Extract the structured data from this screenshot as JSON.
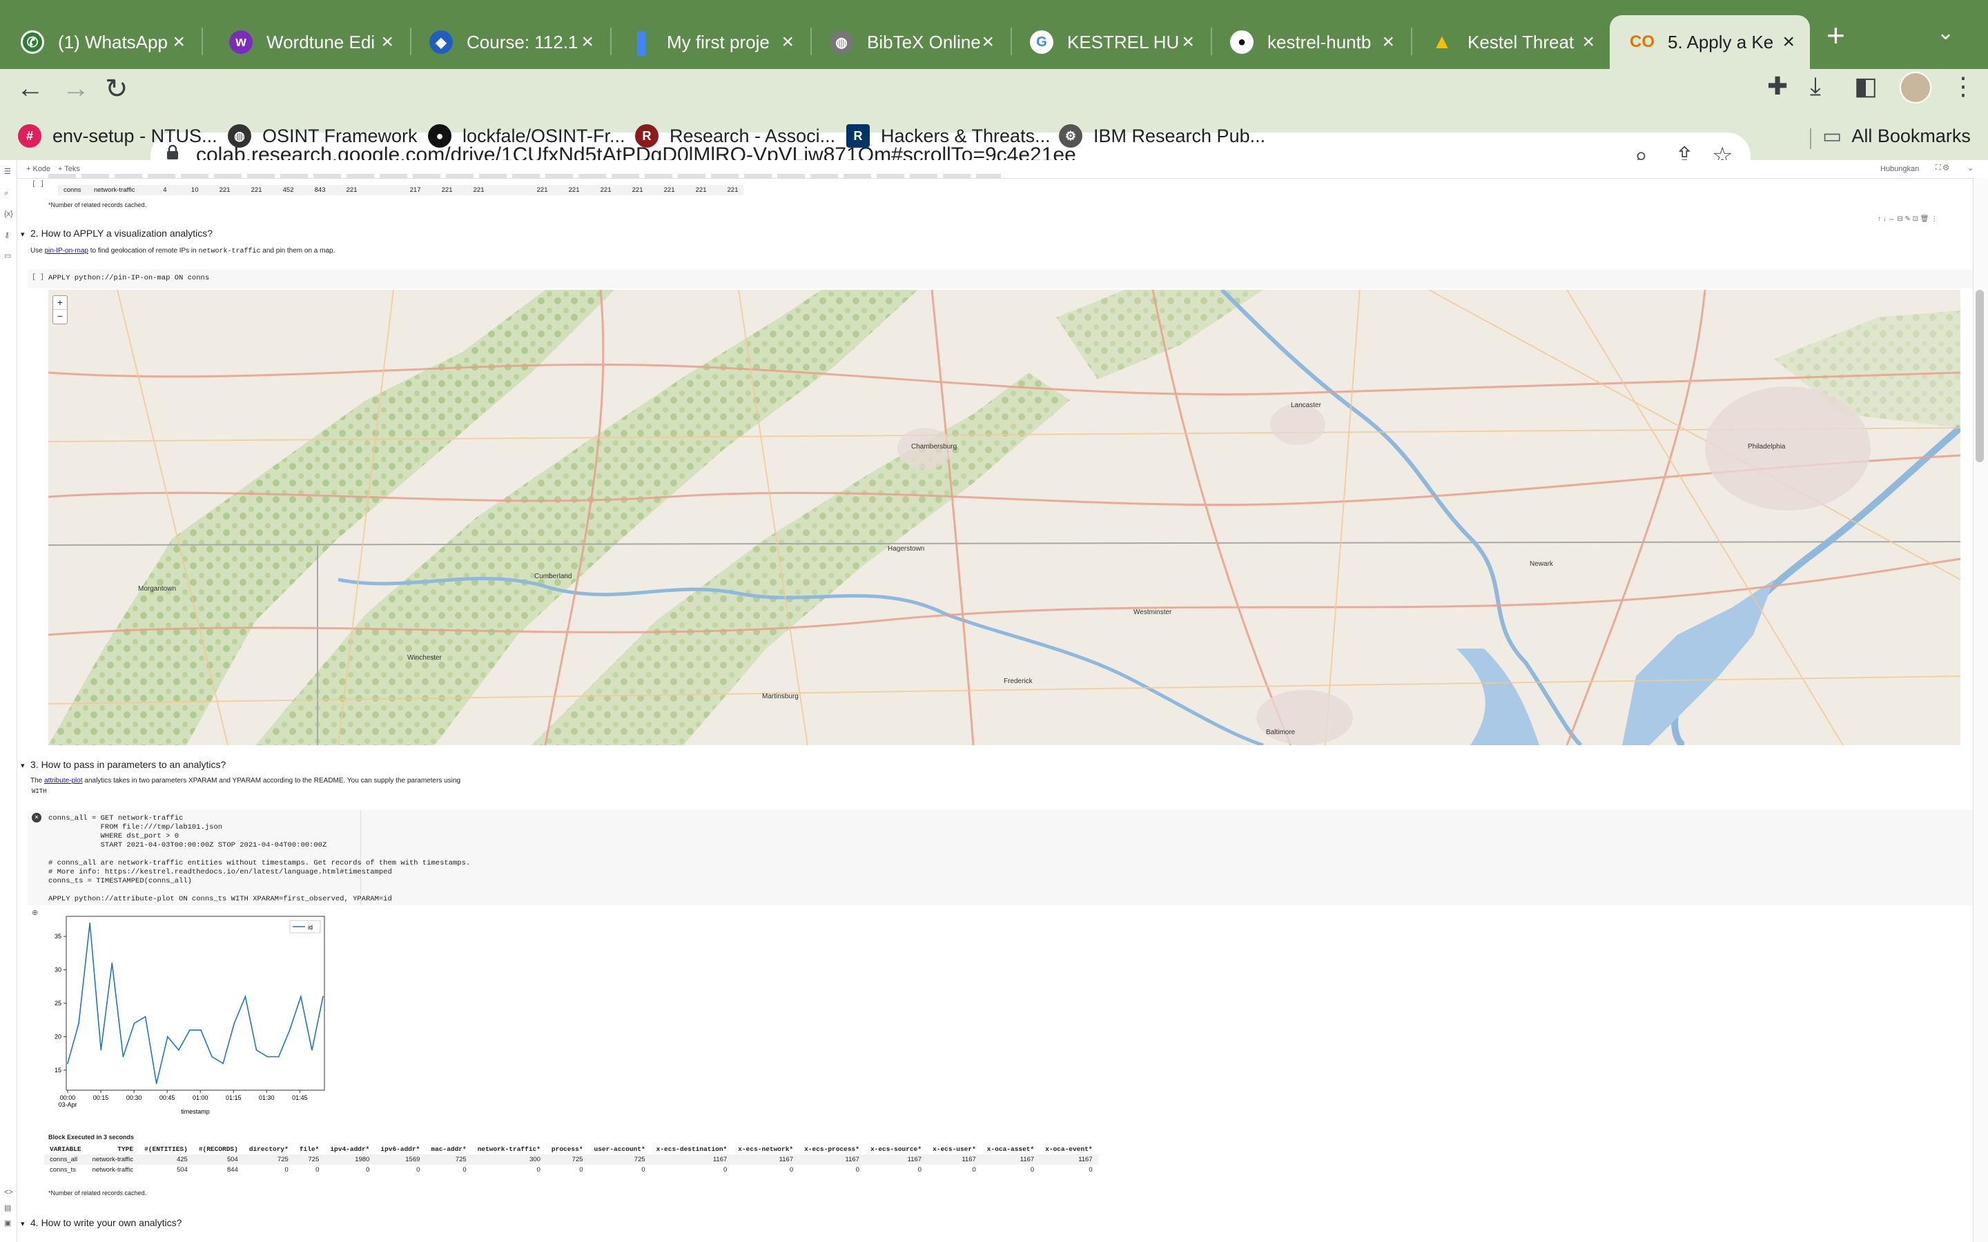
{
  "browser": {
    "tabs": [
      {
        "label": "(1) WhatsApp",
        "icon": "whatsapp-icon",
        "color": "#25d366"
      },
      {
        "label": "Wordtune Edi",
        "icon": "wordtune-icon",
        "color": "#7b2cbf"
      },
      {
        "label": "Course: 112.1",
        "icon": "course-icon",
        "color": "#1f5fbf"
      },
      {
        "label": "My first proje",
        "icon": "bookmark-icon",
        "color": "#4285f4"
      },
      {
        "label": "BibTeX Online",
        "icon": "globe-icon",
        "color": "#888888"
      },
      {
        "label": "KESTREL HU",
        "icon": "google-icon",
        "color": "#ffffff"
      },
      {
        "label": "kestrel-huntb",
        "icon": "github-icon",
        "color": "#111111"
      },
      {
        "label": "Kestel Threat",
        "icon": "drive-icon",
        "color": "#fbbc04"
      },
      {
        "label": "5. Apply a Ke",
        "icon": "colab-icon",
        "color": "#f9ab00",
        "active": true
      }
    ],
    "url": "colab.research.google.com/drive/1CUfxNd5tAtPDgD0lMlRQ-VpVLiw871Om#scrollTo=9c4e21ee",
    "bookmarks": [
      {
        "label": "env-setup - NTUS...",
        "icon": "slack-icon",
        "color": "#e01e5a"
      },
      {
        "label": "OSINT Framework",
        "icon": "globe-icon",
        "color": "#333333"
      },
      {
        "label": "lockfale/OSINT-Fr...",
        "icon": "github-icon",
        "color": "#111111"
      },
      {
        "label": "Research - Associ...",
        "icon": "research-icon",
        "color": "#8b1a1a"
      },
      {
        "label": "Hackers & Threats...",
        "icon": "rsac-icon",
        "color": "#003366"
      },
      {
        "label": "IBM Research Pub...",
        "icon": "ibm-icon",
        "color": "#555555"
      }
    ],
    "all_bookmarks": "All Bookmarks"
  },
  "colab": {
    "add_code": "+ Kode",
    "add_text": "+ Teks",
    "connect": "Hubungkan",
    "top_table": {
      "row": [
        "conns",
        "network-traffic",
        "4",
        "10",
        "221",
        "221",
        "452",
        "843",
        "221",
        "",
        "217",
        "221",
        "221",
        "",
        "221",
        "221",
        "221",
        "221",
        "221",
        "221",
        "221"
      ],
      "note": "*Number of related records cached."
    },
    "section2": {
      "title": "2. How to APPLY a visualization analytics?",
      "desc_pre": "Use",
      "desc_link": "pin-IP-on-map",
      "desc_post": "to find geolocation of remote IPs in",
      "desc_code": "network-traffic",
      "desc_end": "and pin them on a map.",
      "cell_prompt": "[ ]",
      "cell_code": "APPLY python://pin-IP-on-map ON conns"
    },
    "map_labels": [
      "Chambersburg",
      "Lancaster",
      "Philadelphia",
      "Hagerstown",
      "Cumberland",
      "Frederick",
      "Westminster",
      "Baltimore",
      "Newark",
      "Martinsburg",
      "Morgantown",
      "Winchester"
    ],
    "section3": {
      "title": "3. How to pass in parameters to an analytics?",
      "desc1_pre": "The",
      "desc1_link": "attribute-plot",
      "desc1_post": "analytics takes in two parameters XPARAM and YPARAM according to the README. You can supply the parameters using",
      "desc2": "WITH",
      "code_lines": [
        "conns_all = GET network-traffic",
        "            FROM file:///tmp/lab101.json",
        "            WHERE dst_port > 0",
        "            START 2021-04-03T00:00:00Z STOP 2021-04-04T00:00:00Z",
        "",
        "# conns_all are network-traffic entities without timestamps. Get records of them with timestamps.",
        "# More info: https://kestrel.readthedocs.io/en/latest/language.html#timestamped",
        "conns_ts = TIMESTAMPED(conns_all)",
        "",
        "APPLY python://attribute-plot ON conns_ts WITH XPARAM=first_observed, YPARAM=id"
      ]
    },
    "chart_data": {
      "type": "line",
      "xlabel": "timestamp",
      "ylabel": "",
      "legend": "id",
      "legend_position": "top-right",
      "xticks": [
        "00:00\n03-Apr",
        "00:15",
        "00:30",
        "00:45",
        "01:00",
        "01:15",
        "01:30",
        "01:45"
      ],
      "yticks": [
        15,
        20,
        25,
        30,
        35
      ],
      "ylim": [
        12,
        38
      ],
      "series": [
        {
          "name": "id",
          "values": [
            16,
            22,
            37,
            18,
            31,
            17,
            22,
            23,
            13,
            20,
            18,
            21,
            21,
            17,
            16,
            22,
            26,
            18,
            17,
            17,
            21,
            26,
            18,
            26
          ]
        }
      ]
    },
    "exec_note": "Block Executed in 3 seconds",
    "result_table": {
      "headers": [
        "VARIABLE",
        "TYPE",
        "#(ENTITIES)",
        "#(RECORDS)",
        "directory*",
        "file*",
        "ipv4-addr*",
        "ipv6-addr*",
        "mac-addr*",
        "network-traffic*",
        "process*",
        "user-account*",
        "x-ecs-destination*",
        "x-ecs-network*",
        "x-ecs-process*",
        "x-ecs-source*",
        "x-ecs-user*",
        "x-oca-asset*",
        "x-oca-event*"
      ],
      "rows": [
        [
          "conns_all",
          "network-traffic",
          "425",
          "504",
          "725",
          "725",
          "1980",
          "1569",
          "725",
          "300",
          "725",
          "725",
          "1167",
          "1167",
          "1167",
          "1167",
          "1167",
          "1167",
          "1167"
        ],
        [
          "conns_ts",
          "network-traffic",
          "504",
          "844",
          "0",
          "0",
          "0",
          "0",
          "0",
          "0",
          "0",
          "0",
          "0",
          "0",
          "0",
          "0",
          "0",
          "0",
          "0"
        ]
      ],
      "note": "*Number of related records cached."
    },
    "section4": {
      "title": "4. How to write your own analytics?"
    }
  }
}
